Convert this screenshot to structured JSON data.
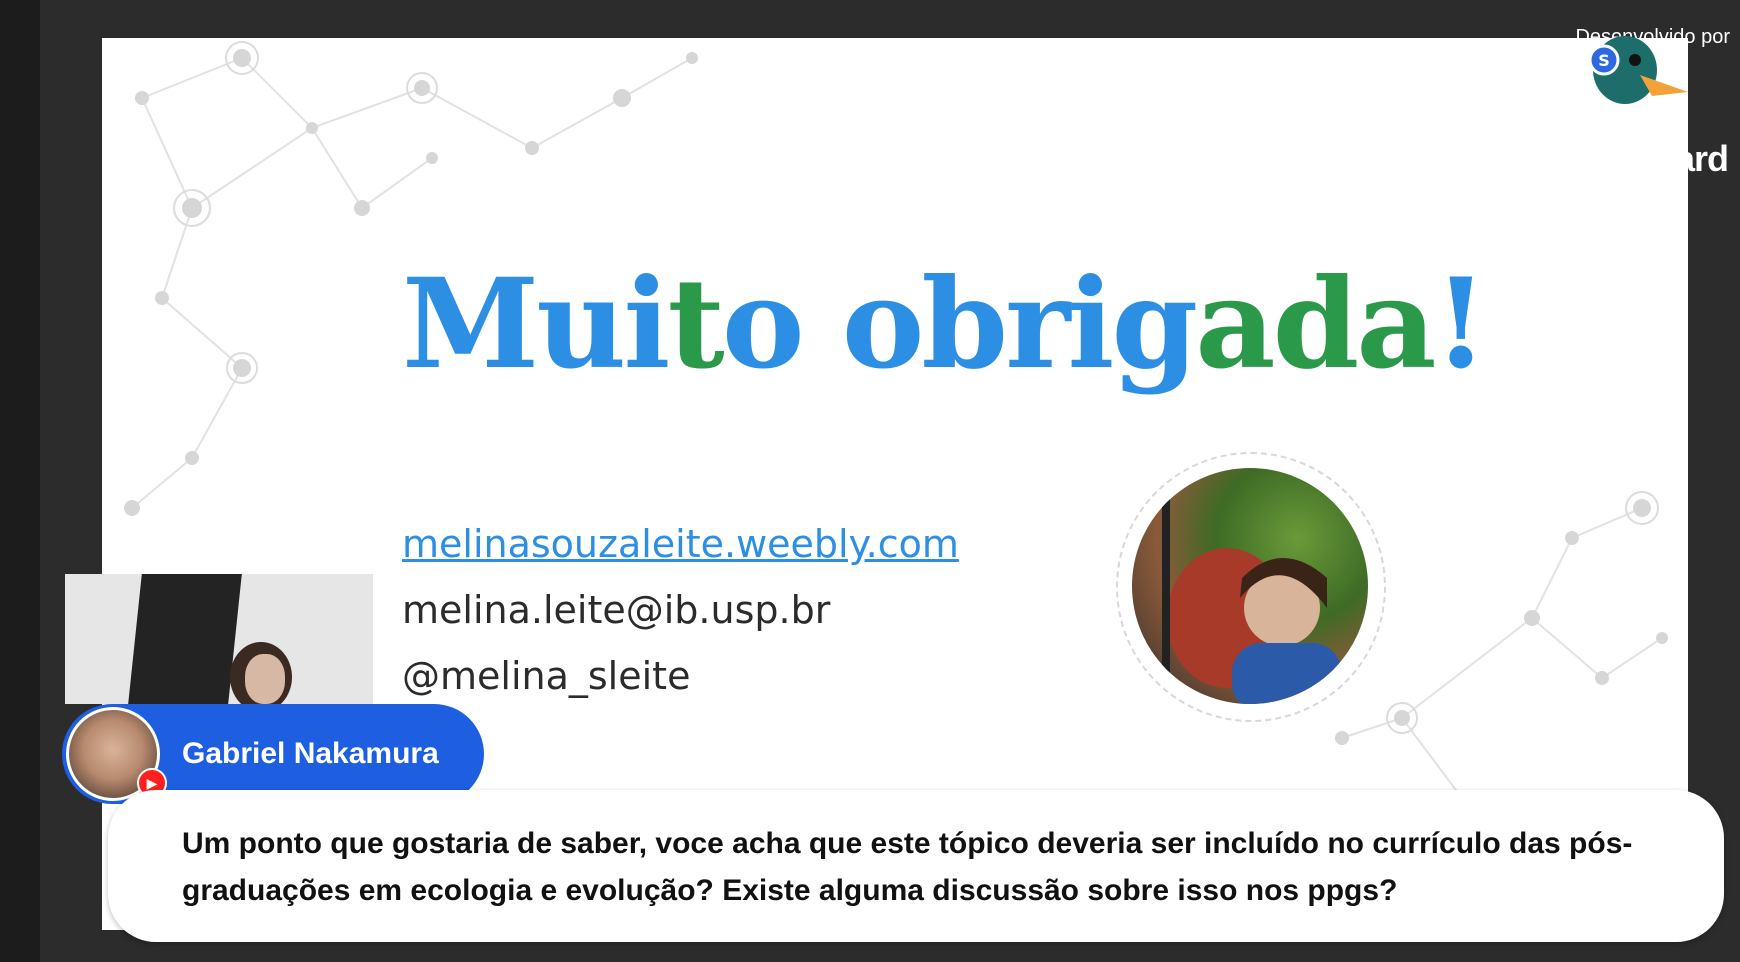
{
  "slide": {
    "title_parts": [
      {
        "text": "Mui",
        "color": "#2d8fe4"
      },
      {
        "text": "t",
        "color": "#2a9a4a"
      },
      {
        "text": "o obrig",
        "color": "#2d8fe4"
      },
      {
        "text": "ada",
        "color": "#2a9a4a"
      },
      {
        "text": "!",
        "color": "#2d8fe4"
      }
    ],
    "website": "melinasouzaleite.weebly.com",
    "email": "melina.leite@ib.usp.br",
    "handle": "@melina_sleite"
  },
  "presenter": {
    "name": "Gabriel Nakamura",
    "platform_icon": "youtube-icon"
  },
  "comment": {
    "text": "Um ponto que gostaria de saber, voce acha que este tópico deveria ser incluído no currículo das pós-graduações em ecologia e evolução? Existe alguma discussão sobre isso nos ppgs?"
  },
  "branding": {
    "label": "Desenvolvido por",
    "name": "StreamYard",
    "logo_icon": "duck-icon"
  },
  "colors": {
    "accent_blue": "#2d8fe4",
    "accent_green": "#2a9a4a",
    "chip_blue": "#1d5fe0",
    "youtube_red": "#ff1f1f"
  }
}
